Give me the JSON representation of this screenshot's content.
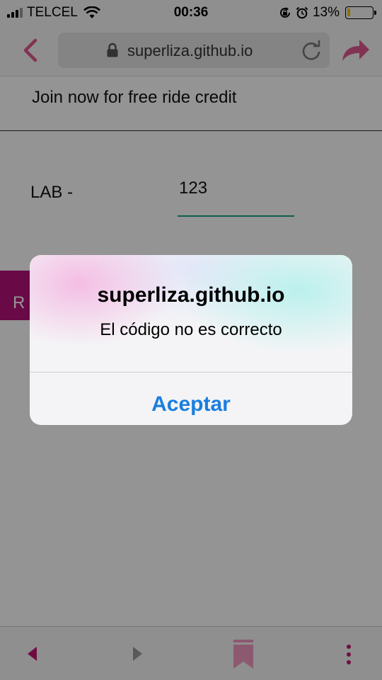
{
  "status_bar": {
    "carrier": "TELCEL",
    "time": "00:36",
    "battery_percent": "13%",
    "battery_level": 0.13,
    "icons": [
      "signal-icon",
      "wifi-icon",
      "rotation-lock-icon",
      "alarm-icon",
      "battery-icon"
    ]
  },
  "browser": {
    "url": "superliza.github.io",
    "icons": [
      "back-arrow-icon",
      "lock-icon",
      "reload-icon",
      "share-icon"
    ]
  },
  "page": {
    "promo_text": "Join now for free ride credit",
    "code_label": "LAB -",
    "code_value": "123",
    "redeem_label": "R",
    "accent_color": "#b5127a",
    "input_underline_color": "#1aa38a"
  },
  "alert": {
    "title": "superliza.github.io",
    "message": "El código no es correcto",
    "button_label": "Aceptar",
    "button_color": "#1a7ee0"
  },
  "bottom_bar": {
    "icons": [
      "nav-back-icon",
      "nav-forward-icon",
      "bookmark-icon",
      "menu-icon"
    ]
  }
}
